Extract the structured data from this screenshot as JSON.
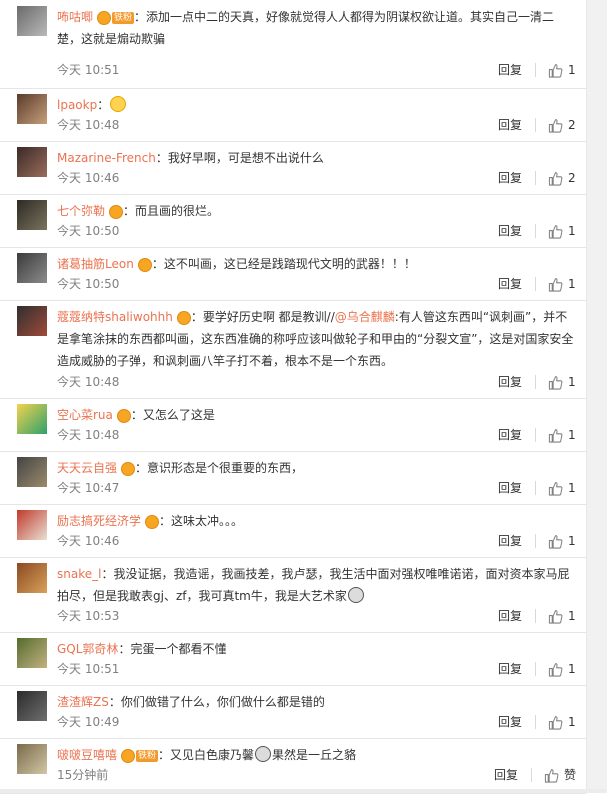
{
  "reply_label": "回复",
  "like_label_zan": "赞",
  "colors": {
    "username": "#eb7350",
    "time": "#808080",
    "text": "#333333",
    "badge": "#f6a623"
  },
  "comments": [
    {
      "username": "咘咕唧",
      "badges": [
        "vip",
        "fans"
      ],
      "fans_label": "铁粉",
      "text": "：添加一点中二的天真，好像就觉得人人都得为阴谋权欲让道。其实自己一清二楚，这就是煽动欺骗",
      "time": "今天 10:51",
      "likes": "1"
    },
    {
      "username": "lpaokp",
      "badges": [],
      "text": "：",
      "emoji": "crying-emoji",
      "time": "今天 10:48",
      "likes": "2"
    },
    {
      "username": "Mazarine-French",
      "badges": [],
      "text": "：我好早啊，可是想不出说什么",
      "time": "今天 10:46",
      "likes": "2"
    },
    {
      "username": "七个弥勒",
      "badges": [
        "vip"
      ],
      "text": "：而且画的很烂。",
      "time": "今天 10:50",
      "likes": "1"
    },
    {
      "username": "诸葛抽筋Leon",
      "badges": [
        "vip"
      ],
      "text": "：这不叫画，这已经是践踏现代文明的武器！！！",
      "time": "今天 10:50",
      "likes": "1"
    },
    {
      "username": "蔻蔻纳特shaliwohhh",
      "badges": [
        "vip"
      ],
      "text_a": "：要学好历史啊 都是教训//",
      "mention": "@乌合麒麟",
      "text_b": ":有人管这东西叫“讽刺画”，并不是拿笔涂抹的东西都叫画，这东西准确的称呼应该叫做轮子和甲由的“分裂文宣”，这是对国家安全造成威胁的子弹，和讽刺画八竿子打不着，根本不是一个东西。",
      "time": "今天 10:48",
      "likes": "1"
    },
    {
      "username": "空心菜rua",
      "badges": [
        "vip"
      ],
      "text": "：又怎么了这是",
      "time": "今天 10:48",
      "likes": "1"
    },
    {
      "username": "天天云自强",
      "badges": [
        "vip"
      ],
      "text": "：意识形态是个很重要的东西，",
      "time": "今天 10:47",
      "likes": "1"
    },
    {
      "username": "励志搞死经济学",
      "badges": [
        "vip"
      ],
      "text": "：这味太冲。。。",
      "time": "今天 10:46",
      "likes": "1"
    },
    {
      "username": "snake_l",
      "badges": [],
      "text": "：我没证据，我造谣，我画技差，我卢瑟，我生活中面对强权唯唯诺诺，面对资本家马屁拍尽，但是我敢表gj、zf，我可真tm牛，我是大艺术家",
      "emoji": "face-emoji",
      "time": "今天 10:53",
      "likes": "1"
    },
    {
      "username": "GQL郭奇林",
      "badges": [],
      "text": "：完蛋一个都看不懂",
      "time": "今天 10:51",
      "likes": "1"
    },
    {
      "username": "渣渣辉ZS",
      "badges": [],
      "text": "：你们做错了什么，你们做什么都是错的",
      "time": "今天 10:49",
      "likes": "1"
    },
    {
      "username": "啵啵豆嘻嘻",
      "badges": [
        "vip",
        "fans"
      ],
      "fans_label": "铁粉",
      "text_a": "：又见白色康乃馨",
      "emoji": "face-emoji",
      "text_b": "果然是一丘之貉",
      "time": "15分钟前",
      "likes": "赞"
    }
  ]
}
